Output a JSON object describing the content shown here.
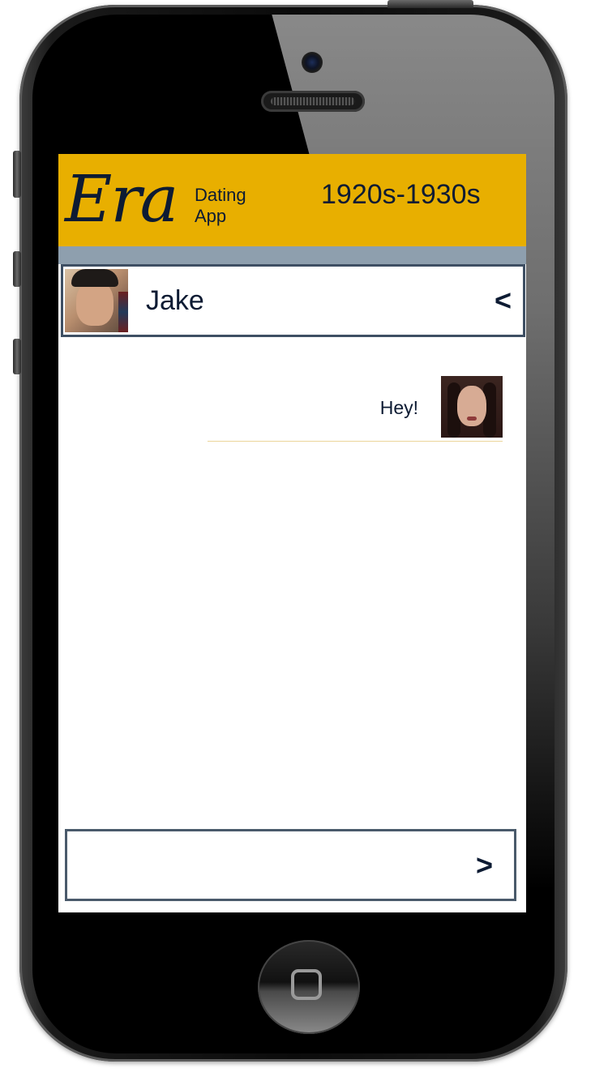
{
  "header": {
    "logo": "Era",
    "logo_sub_line1": "Dating",
    "logo_sub_line2": "App",
    "era_range": "1920s-1930s"
  },
  "contact": {
    "name": "Jake",
    "back_label": "<"
  },
  "messages": [
    {
      "text": "Hey!",
      "sender": "self"
    }
  ],
  "compose": {
    "value": "",
    "placeholder": "",
    "send_label": ">"
  },
  "colors": {
    "header_bg": "#e8af00",
    "band": "#8e9fae",
    "text_dark": "#0d1b33",
    "border": "#3e4f63"
  }
}
